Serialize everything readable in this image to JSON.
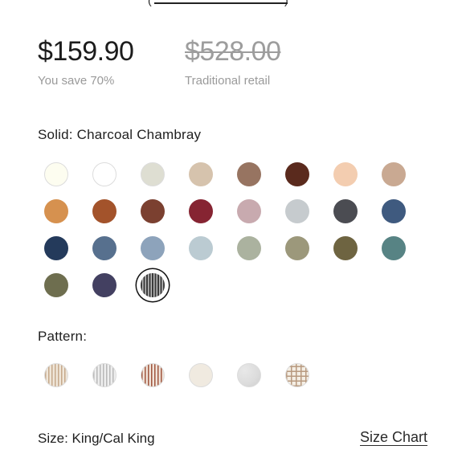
{
  "pricing": {
    "price": "$159.90",
    "savings": "You save 70%",
    "retail_price": "$528.00",
    "retail_label": "Traditional retail"
  },
  "solid": {
    "label": "Solid: Charcoal Chambray",
    "swatches": [
      {
        "color": "#fdfdf0",
        "name": "ivory"
      },
      {
        "color": "#ffffff",
        "name": "white"
      },
      {
        "color": "#deded2",
        "name": "light-gray"
      },
      {
        "color": "#d6c3ad",
        "name": "sand"
      },
      {
        "color": "#977461",
        "name": "mocha"
      },
      {
        "color": "#5a2a1d",
        "name": "chocolate"
      },
      {
        "color": "#f3cdb0",
        "name": "blush"
      },
      {
        "color": "#c9a992",
        "name": "tan"
      },
      {
        "color": "#d6914f",
        "name": "amber"
      },
      {
        "color": "#a3532b",
        "name": "rust"
      },
      {
        "color": "#7b4030",
        "name": "brick"
      },
      {
        "color": "#862432",
        "name": "burgundy"
      },
      {
        "color": "#c8aaaf",
        "name": "mauve"
      },
      {
        "color": "#c6cbce",
        "name": "silver"
      },
      {
        "color": "#4b4c52",
        "name": "charcoal"
      },
      {
        "color": "#3f5a7f",
        "name": "slate-blue"
      },
      {
        "color": "#243a5b",
        "name": "navy"
      },
      {
        "color": "#57708e",
        "name": "denim"
      },
      {
        "color": "#8da3bb",
        "name": "dusty-blue"
      },
      {
        "color": "#bbcbd2",
        "name": "mist"
      },
      {
        "color": "#abb29f",
        "name": "sage"
      },
      {
        "color": "#9c987b",
        "name": "olive-gray"
      },
      {
        "color": "#6e6441",
        "name": "moss"
      },
      {
        "color": "#578384",
        "name": "teal"
      },
      {
        "color": "#6e6e4f",
        "name": "olive"
      },
      {
        "color": "#434061",
        "name": "indigo"
      },
      {
        "color": "#5a5a5a",
        "name": "charcoal-chambray",
        "selected": true
      }
    ]
  },
  "pattern": {
    "label": "Pattern:",
    "swatches": [
      {
        "name": "tan-stripe",
        "base": "#efe6d9",
        "stripe": "#c5a88a"
      },
      {
        "name": "gray-stripe",
        "base": "#eeeeee",
        "stripe": "#b8b8b8"
      },
      {
        "name": "rust-stripe",
        "base": "#f0e4da",
        "stripe": "#a0553d"
      },
      {
        "name": "cream-solid",
        "base": "#f0eae0",
        "stripe": "#f0eae0"
      },
      {
        "name": "heather-gray",
        "base": "#dcdcdc",
        "stripe": "#cfcfcf"
      },
      {
        "name": "tan-grid",
        "base": "#f4eee4",
        "stripe": "#b89a80"
      }
    ]
  },
  "size": {
    "label": "Size: King/Cal King",
    "chart_link": "Size Chart"
  }
}
